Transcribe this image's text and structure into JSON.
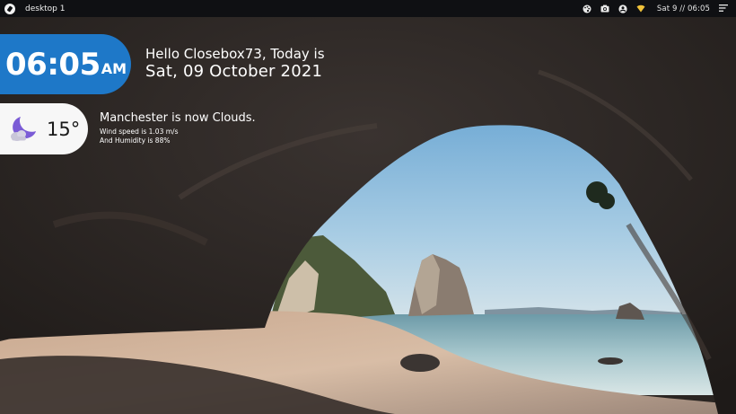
{
  "topbar": {
    "workspace_label": "desktop 1",
    "clock": "Sat 9 // 06:05",
    "icons": [
      "palette-icon",
      "screenshot-icon",
      "user-icon",
      "network-icon",
      "menu-icon"
    ]
  },
  "time_widget": {
    "time": "06:05",
    "ampm": "AM",
    "greeting": "Hello Closebox73, Today is",
    "date": "Sat, 09 October 2021"
  },
  "weather_widget": {
    "icon": "moon-cloud-icon",
    "temperature": "15°",
    "summary": "Manchester is now Clouds.",
    "wind": "Wind speed is 1.03 m/s",
    "humidity": "And Humidity is 88%"
  },
  "colors": {
    "accent": "#1e78c8",
    "panel": "#0f1013",
    "moon": "#7b5cd6"
  }
}
